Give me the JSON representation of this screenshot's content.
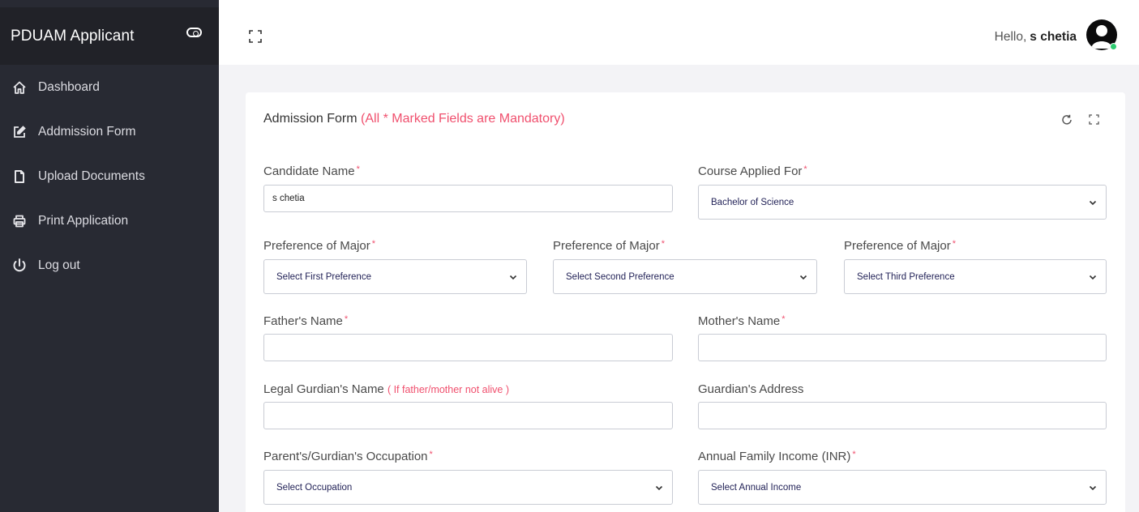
{
  "sidebar": {
    "brand": "PDUAM Applicant",
    "items": [
      {
        "label": "Dashboard",
        "icon": "home-icon"
      },
      {
        "label": "Addmission Form",
        "icon": "edit-icon"
      },
      {
        "label": "Upload Documents",
        "icon": "file-icon"
      },
      {
        "label": "Print Application",
        "icon": "printer-icon"
      },
      {
        "label": "Log out",
        "icon": "power-icon"
      }
    ]
  },
  "header": {
    "greeting": "Hello,",
    "username": "s chetia"
  },
  "form": {
    "title": "Admission Form",
    "mandatory_note": "(All * Marked Fields are Mandatory)",
    "required_mark": "*",
    "candidate_name": {
      "label": "Candidate Name",
      "value": "s chetia"
    },
    "course": {
      "label": "Course Applied For",
      "value": "Bachelor of Science"
    },
    "major1": {
      "label": "Preference of Major",
      "value": "Select First Preference"
    },
    "major2": {
      "label": "Preference of Major",
      "value": "Select Second Preference"
    },
    "major3": {
      "label": "Preference of Major",
      "value": "Select Third Preference"
    },
    "father_name": {
      "label": "Father's Name",
      "value": ""
    },
    "mother_name": {
      "label": "Mother's Name",
      "value": ""
    },
    "guardian_name": {
      "label": "Legal Gurdian's Name",
      "note": "( If father/mother not alive )",
      "value": ""
    },
    "guardian_address": {
      "label": "Guardian's Address",
      "value": ""
    },
    "occupation": {
      "label": "Parent's/Gurdian's Occupation",
      "value": "Select Occupation"
    },
    "income": {
      "label": "Annual Family Income (INR)",
      "value": "Select Annual Income"
    }
  },
  "colors": {
    "sidebar_bg": "#282a33",
    "sidebar_header_bg": "#212228",
    "mandatory_red": "#f0506e",
    "online_green": "#2ecc71"
  }
}
